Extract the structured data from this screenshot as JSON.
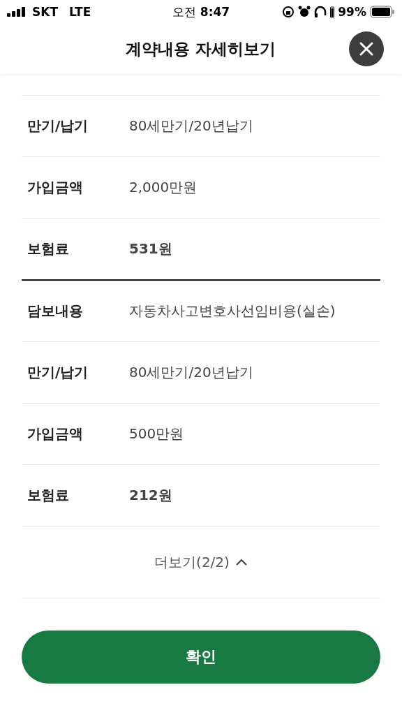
{
  "status_bar": {
    "carrier": "SKT",
    "network": "LTE",
    "time_prefix": "오전",
    "time": "8:47",
    "battery": "99%"
  },
  "header": {
    "title": "계약내용 자세히보기"
  },
  "groups": [
    {
      "rows": [
        {
          "label": "만기/납기",
          "value": "80세만기/20년납기",
          "emphasis": false
        },
        {
          "label": "가입금액",
          "value": "2,000만원",
          "emphasis": false
        },
        {
          "label": "보험료",
          "value": "531원",
          "emphasis": true
        }
      ]
    },
    {
      "rows": [
        {
          "label": "담보내용",
          "value": "자동차사고변호사선임비용(실손)",
          "emphasis": false
        },
        {
          "label": "만기/납기",
          "value": "80세만기/20년납기",
          "emphasis": false
        },
        {
          "label": "가입금액",
          "value": "500만원",
          "emphasis": false
        },
        {
          "label": "보험료",
          "value": "212원",
          "emphasis": true
        }
      ]
    }
  ],
  "more": {
    "label": "더보기(2/2)",
    "expanded": true
  },
  "confirm": "확인"
}
